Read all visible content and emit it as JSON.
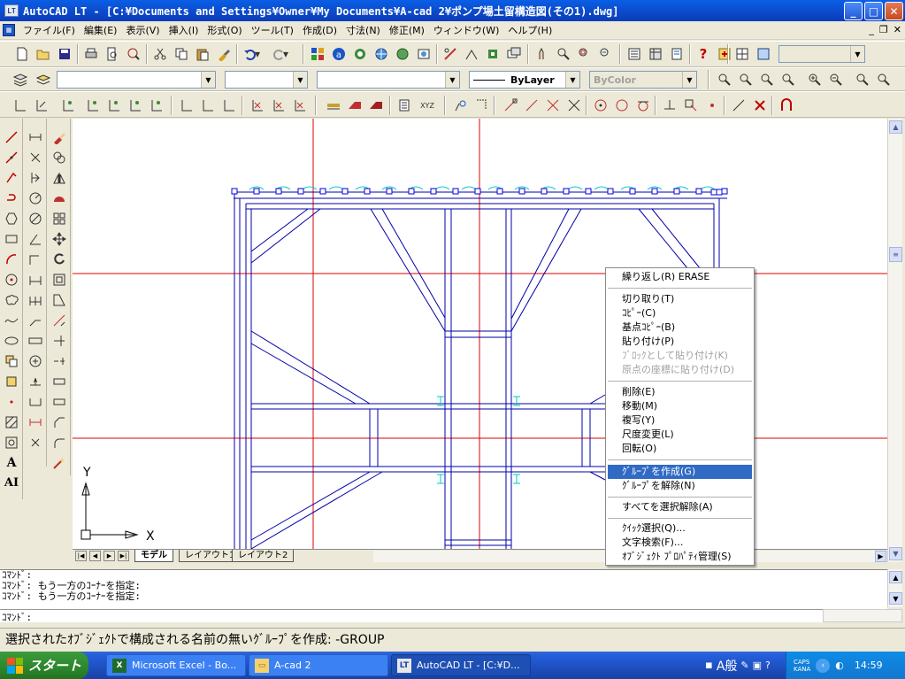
{
  "window": {
    "title": "AutoCAD LT - [C:¥Documents and Settings¥Owner¥My Documents¥A-cad 2¥ポンプ場土留構造図(その1).dwg]",
    "app_icon_label": "LT"
  },
  "menubar": {
    "items": [
      "ファイル(F)",
      "編集(E)",
      "表示(V)",
      "挿入(I)",
      "形式(O)",
      "ツール(T)",
      "作成(D)",
      "寸法(N)",
      "修正(M)",
      "ウィンドウ(W)",
      "ヘルプ(H)"
    ]
  },
  "properties_toolbar": {
    "layer_value": "",
    "linetype_value": "ByLayer",
    "color_value": "ByColor"
  },
  "layout_tabs": [
    "モデル",
    "レイアウト1",
    "レイアウト2"
  ],
  "ucs": {
    "x_label": "X",
    "y_label": "Y"
  },
  "context_menu": {
    "items": [
      {
        "label": "繰り返し(R) ERASE",
        "disabled": false
      },
      {
        "label": "切り取り(T)",
        "disabled": false
      },
      {
        "label": "ｺﾋﾟｰ(C)",
        "disabled": false
      },
      {
        "label": "基点ｺﾋﾟｰ(B)",
        "disabled": false
      },
      {
        "label": "貼り付け(P)",
        "disabled": false
      },
      {
        "label": "ﾌﾞﾛｯｸとして貼り付け(K)",
        "disabled": true
      },
      {
        "label": "原点の座標に貼り付け(D)",
        "disabled": true
      },
      {
        "label": "削除(E)",
        "disabled": false
      },
      {
        "label": "移動(M)",
        "disabled": false
      },
      {
        "label": "複写(Y)",
        "disabled": false
      },
      {
        "label": "尺度変更(L)",
        "disabled": false
      },
      {
        "label": "回転(O)",
        "disabled": false
      },
      {
        "label": "ｸﾞﾙｰﾌﾟを作成(G)",
        "disabled": false,
        "highlighted": true
      },
      {
        "label": "ｸﾞﾙｰﾌﾟを解除(N)",
        "disabled": false
      },
      {
        "label": "すべてを選択解除(A)",
        "disabled": false
      },
      {
        "label": "ｸｲｯｸ選択(Q)...",
        "disabled": false
      },
      {
        "label": "文字検索(F)...",
        "disabled": false
      },
      {
        "label": "ｵﾌﾞｼﾞｪｸﾄ ﾌﾟﾛﾊﾟﾃｨ管理(S)",
        "disabled": false
      }
    ]
  },
  "command_window": {
    "lines": [
      "ｺﾏﾝﾄﾞ:",
      "ｺﾏﾝﾄﾞ: もう一方のｺｰﾅｰを指定:",
      "ｺﾏﾝﾄﾞ: もう一方のｺｰﾅｰを指定:"
    ],
    "prompt": "ｺﾏﾝﾄﾞ:"
  },
  "status_text": "選択されたｵﾌﾞｼﾞｪｸﾄで構成される名前の無いｸﾞﾙｰﾌﾟを作成:  -GROUP",
  "taskbar": {
    "start_label": "スタート",
    "items": [
      {
        "label": "Microsoft Excel - Bo...",
        "active": false
      },
      {
        "label": "A-cad 2",
        "active": false
      },
      {
        "label": "AutoCAD LT - [C:¥D...",
        "active": true
      }
    ],
    "tray_ime": "A般",
    "caps": "CAPS",
    "kana": "KANA",
    "clock": "14:59"
  },
  "colors": {
    "title_blue": "#0c49c9",
    "drawing_line": "#0000a8",
    "grip_cyan": "#00c8c8",
    "axis_red": "#e00000",
    "highlight": "#316ac5"
  }
}
